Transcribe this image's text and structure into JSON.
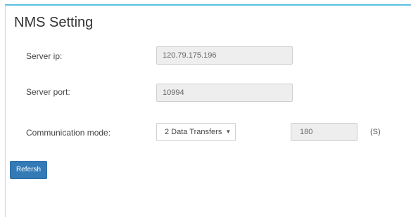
{
  "page": {
    "title": "NMS Setting"
  },
  "server_ip": {
    "label": "Server ip:",
    "value": "120.79.175.196"
  },
  "server_port": {
    "label": "Server port:",
    "value": "10994"
  },
  "communication_mode": {
    "label": "Communication mode:",
    "selected": "2 Data Transfers",
    "interval_value": "180",
    "interval_unit": "(S)"
  },
  "actions": {
    "refresh_label": "Refersh"
  },
  "colors": {
    "accent_border": "#5bc0de",
    "button_primary": "#337ab7"
  }
}
